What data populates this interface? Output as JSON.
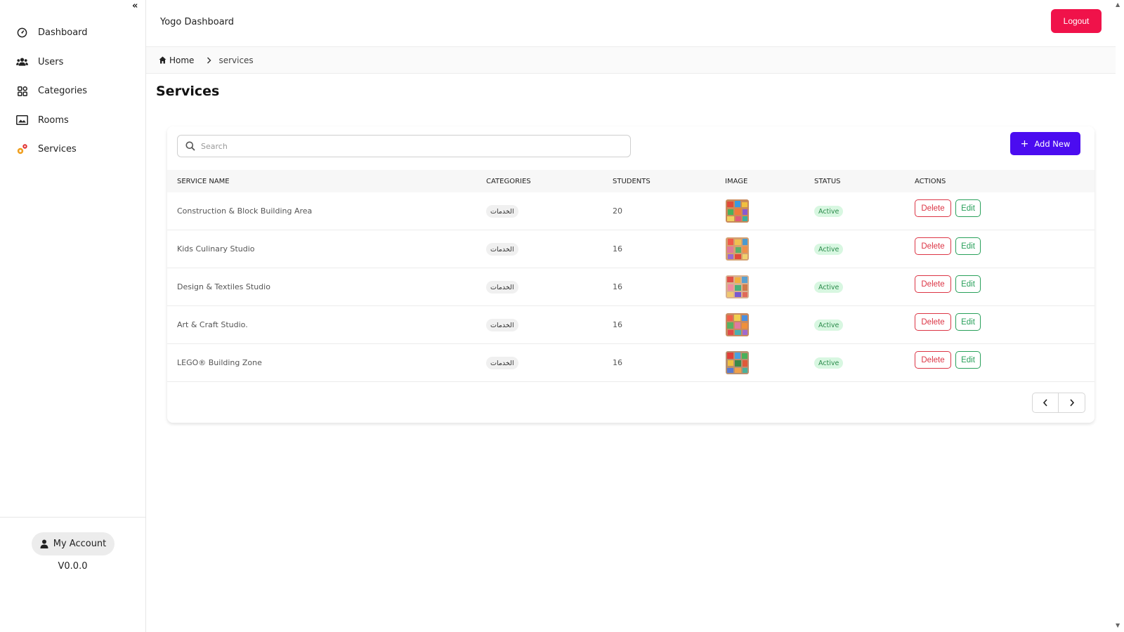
{
  "app": {
    "title": "Yogo Dashboard",
    "logout_label": "Logout"
  },
  "sidebar": {
    "items": [
      {
        "label": "Dashboard",
        "icon": "gauge-icon"
      },
      {
        "label": "Users",
        "icon": "users-icon"
      },
      {
        "label": "Categories",
        "icon": "grid-icon"
      },
      {
        "label": "Rooms",
        "icon": "image-frame-icon"
      },
      {
        "label": "Services",
        "icon": "gears-icon"
      }
    ],
    "account_label": "My Account",
    "version": "V0.0.0"
  },
  "breadcrumb": {
    "home": "Home",
    "current": "services"
  },
  "page": {
    "title": "Services"
  },
  "toolbar": {
    "search_placeholder": "Search",
    "search_value": "",
    "add_label": "Add New"
  },
  "table": {
    "headers": [
      "SERVICE NAME",
      "CATEGORIES",
      "STUDENTS",
      "IMAGE",
      "STATUS",
      "ACTIONS"
    ],
    "rows": [
      {
        "name": "Construction & Block Building Area",
        "category": "الخدمات",
        "students": "20",
        "status": "Active"
      },
      {
        "name": "Kids Culinary Studio",
        "category": "الخدمات",
        "students": "16",
        "status": "Active"
      },
      {
        "name": "Design & Textiles Studio",
        "category": "الخدمات",
        "students": "16",
        "status": "Active"
      },
      {
        "name": "Art & Craft Studio.",
        "category": "الخدمات",
        "students": "16",
        "status": "Active"
      },
      {
        "name": "LEGO® Building Zone",
        "category": "الخدمات",
        "students": "16",
        "status": "Active"
      }
    ],
    "delete_label": "Delete",
    "edit_label": "Edit"
  },
  "colors": {
    "logout": "#f0124a",
    "primary": "#4b0cf0",
    "danger": "#dc3545",
    "success": "#28a05a",
    "active_badge_bg": "#d8f7e1"
  }
}
